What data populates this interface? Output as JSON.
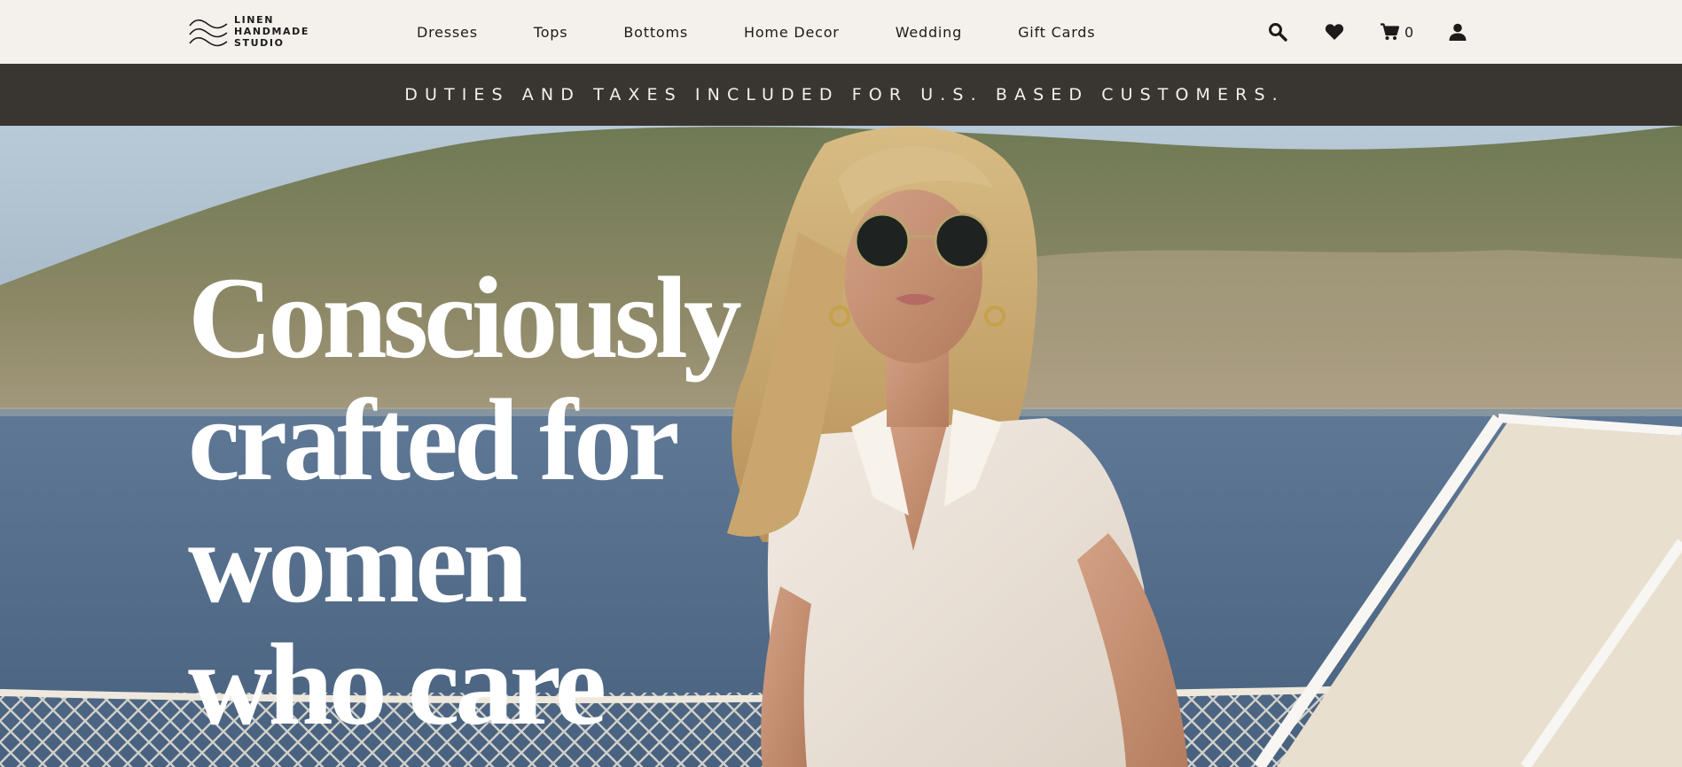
{
  "header": {
    "logo": {
      "lines": [
        "LINEN",
        "HANDMADE",
        "STUDIO"
      ]
    },
    "nav": [
      {
        "label": "Dresses"
      },
      {
        "label": "Tops"
      },
      {
        "label": "Bottoms"
      },
      {
        "label": "Home Decor"
      },
      {
        "label": "Wedding"
      },
      {
        "label": "Gift Cards"
      }
    ],
    "actions": {
      "search_icon": "search-icon",
      "wishlist_icon": "heart-icon",
      "cart_icon": "cart-icon",
      "cart_count": "0",
      "account_icon": "user-icon"
    }
  },
  "announcement": {
    "text": "DUTIES AND TAXES INCLUDED FOR U.S. BASED CUSTOMERS."
  },
  "hero": {
    "headline_lines": [
      "Consciously",
      "crafted for",
      "women",
      "who care"
    ]
  },
  "colors": {
    "header_bg": "#f4f1ed",
    "announcement_bg": "#393631",
    "announcement_text": "#f4f1ed",
    "hero_text": "#ffffff",
    "ink": "#1c1b19"
  }
}
